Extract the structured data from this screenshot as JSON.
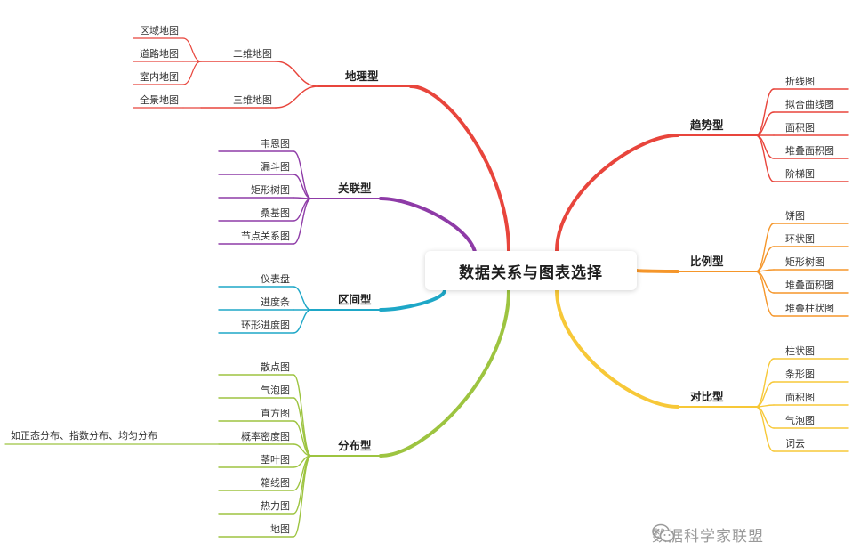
{
  "root": {
    "title": "数据关系与图表选择"
  },
  "colors": {
    "geo": "#e8453c",
    "relation": "#8e3ba7",
    "interval": "#1ea7c7",
    "distribution": "#9dc440",
    "trend": "#e8453c",
    "proportion": "#f5962a",
    "comparison": "#f7c838"
  },
  "branches": {
    "geo": {
      "label": "地理型",
      "children": [
        "二维地图",
        "三维地图"
      ],
      "sub": {
        "二维地图": [
          "区域地图",
          "道路地图",
          "室内地图"
        ],
        "三维地图": [
          "全景地图"
        ]
      }
    },
    "relation": {
      "label": "关联型",
      "children": [
        "韦恩图",
        "漏斗图",
        "矩形树图",
        "桑基图",
        "节点关系图"
      ]
    },
    "interval": {
      "label": "区间型",
      "children": [
        "仪表盘",
        "进度条",
        "环形进度图"
      ]
    },
    "distribution": {
      "label": "分布型",
      "children": [
        "散点图",
        "气泡图",
        "直方图",
        "概率密度图",
        "茎叶图",
        "箱线图",
        "热力图",
        "地图"
      ],
      "note": "如正态分布、指数分布、均匀分布"
    },
    "trend": {
      "label": "趋势型",
      "children": [
        "折线图",
        "拟合曲线图",
        "面积图",
        "堆叠面积图",
        "阶梯图"
      ]
    },
    "proportion": {
      "label": "比例型",
      "children": [
        "饼图",
        "环状图",
        "矩形树图",
        "堆叠面积图",
        "堆叠柱状图"
      ]
    },
    "comparison": {
      "label": "对比型",
      "children": [
        "柱状图",
        "条形图",
        "面积图",
        "气泡图",
        "词云"
      ]
    }
  },
  "watermark": {
    "text": "数据科学家联盟",
    "icon": "wechat-icon"
  }
}
